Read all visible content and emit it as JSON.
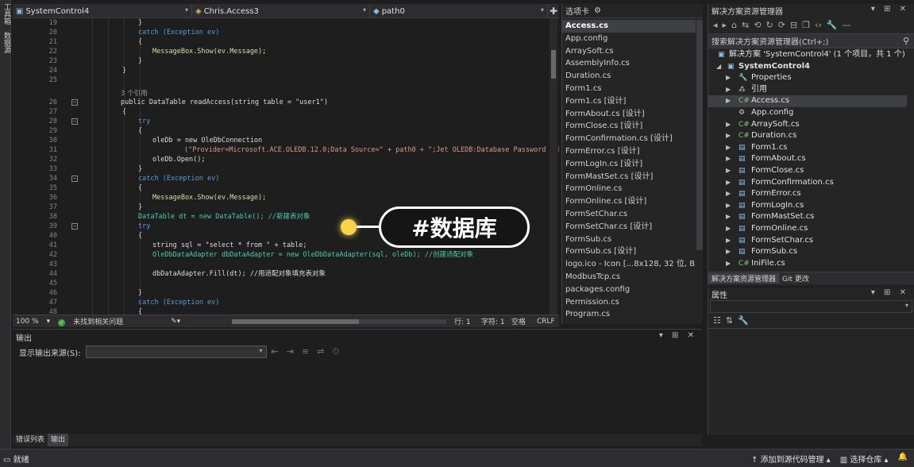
{
  "left_strip": {
    "tab1": "工具箱",
    "tab2": "数据源"
  },
  "editor": {
    "nav": {
      "project": "SystemControl4",
      "class": "Chris.Access3",
      "member": "path0"
    },
    "lines": [
      {
        "n": "19",
        "text": "}"
      },
      {
        "n": "20",
        "text": "catch (Exception ev)"
      },
      {
        "n": "21",
        "text": "{"
      },
      {
        "n": "22",
        "text": "MessageBox.Show(ev.Message);"
      },
      {
        "n": "23",
        "text": "}"
      },
      {
        "n": "24",
        "text": "}"
      },
      {
        "n": "25",
        "text": ""
      },
      {
        "n": "26",
        "text": "public DataTable readAccess(string table = \"user1\")"
      },
      {
        "n": "27",
        "text": "{"
      },
      {
        "n": "28",
        "text": "try"
      },
      {
        "n": "29",
        "text": "{"
      },
      {
        "n": "30",
        "text": "oleDb = new OleDbConnection"
      },
      {
        "n": "31",
        "text": "(\"Provider=Microsoft.ACE.OLEDB.12.0;Data Source=\" + path0 + \";Jet OLEDB:Database Password = hengsh"
      },
      {
        "n": "32",
        "text": "oleDb.Open();"
      },
      {
        "n": "33",
        "text": "}"
      },
      {
        "n": "34",
        "text": "catch (Exception ev)"
      },
      {
        "n": "35",
        "text": "{"
      },
      {
        "n": "36",
        "text": "MessageBox.Show(ev.Message);"
      },
      {
        "n": "37",
        "text": "}"
      },
      {
        "n": "38",
        "text": "DataTable dt = new DataTable(); //新建表对象"
      },
      {
        "n": "39",
        "text": "try"
      },
      {
        "n": "40",
        "text": "{"
      },
      {
        "n": "41",
        "text": "string sql = \"select * from \" + table;"
      },
      {
        "n": "42",
        "text": "OleDbDataAdapter dbDataAdapter = new OleDbDataAdapter(sql, oleDb); //创建适配对象"
      },
      {
        "n": "43",
        "text": ""
      },
      {
        "n": "44",
        "text": "dbDataAdapter.Fill(dt); //用适配对象填充表对象"
      },
      {
        "n": "45",
        "text": ""
      },
      {
        "n": "46",
        "text": "}"
      },
      {
        "n": "47",
        "text": "catch (Exception ev)"
      },
      {
        "n": "48",
        "text": "{"
      }
    ],
    "reference_hint": "3 个引用",
    "status": {
      "zoom": "100 %",
      "issues": "未找到相关问题",
      "line": "行: 1",
      "char": "字符: 1",
      "spaces": "空格",
      "eol": "CRLF"
    }
  },
  "toolbox": {
    "title": "选项卡",
    "items": [
      "Access.cs",
      "App.config",
      "ArraySoft.cs",
      "AssemblyInfo.cs",
      "Duration.cs",
      "Form1.cs",
      "Form1.cs [设计]",
      "FormAbout.cs [设计]",
      "FormClose.cs [设计]",
      "FormConfirmation.cs [设计]",
      "FormError.cs [设计]",
      "FormLogIn.cs [设计]",
      "FormMastSet.cs [设计]",
      "FormOnline.cs",
      "FormOnline.cs [设计]",
      "FormSetChar.cs",
      "FormSetChar.cs [设计]",
      "FormSub.cs",
      "FormSub.cs [设计]",
      "logo.ico - Icon [...8x128, 32 位, BMP]",
      "ModbusTcp.cs",
      "packages.config",
      "Permission.cs",
      "Program.cs"
    ]
  },
  "solution_explorer": {
    "title": "解决方案资源管理器",
    "search_placeholder": "搜索解决方案资源管理器(Ctrl+;)",
    "solution_label": "解决方案 'SystemControl4' (1 个项目，共 1 个)",
    "project": "SystemControl4",
    "items": [
      "Properties",
      "引用",
      "Access.cs",
      "App.config",
      "ArraySoft.cs",
      "Duration.cs",
      "Form1.cs",
      "FormAbout.cs",
      "FormClose.cs",
      "FormConfirmation.cs",
      "FormError.cs",
      "FormLogIn.cs",
      "FormMastSet.cs",
      "FormOnline.cs",
      "FormSetChar.cs",
      "FormSub.cs",
      "IniFile.cs"
    ],
    "tab_active": "解决方案资源管理器",
    "tab_other": "Git 更改"
  },
  "properties": {
    "title": "属性"
  },
  "output": {
    "title": "输出",
    "source_label": "显示输出来源(S):",
    "tab_errors": "错误列表",
    "tab_output": "输出"
  },
  "statusbar": {
    "ready": "就绪",
    "add_source": "添加到源代码管理",
    "select_repo": "选择仓库"
  },
  "overlay": {
    "tag": "#数据库"
  }
}
